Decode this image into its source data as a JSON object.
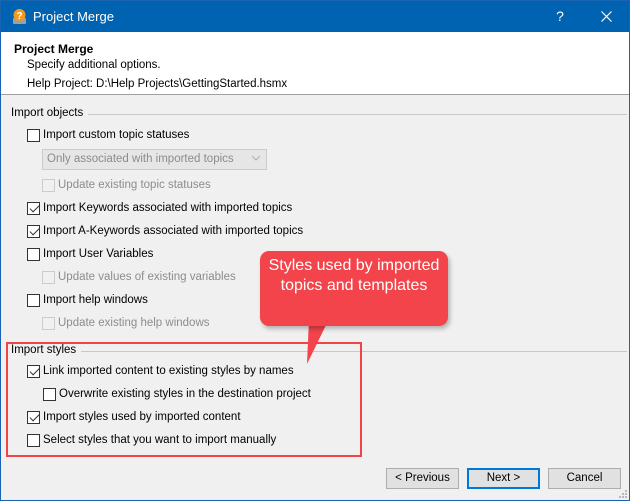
{
  "window": {
    "title": "Project Merge",
    "help_button": "?",
    "close_button": "✕",
    "icon": "help-project-icon"
  },
  "header": {
    "title": "Project Merge",
    "subtitle": "Specify additional options.",
    "help_project": "Help Project: D:\\Help Projects\\GettingStarted.hsmx"
  },
  "import_objects": {
    "label": "Import objects",
    "items": [
      {
        "label": "Import custom topic statuses",
        "checked": false,
        "enabled": true
      },
      {
        "label": "Update existing topic statuses",
        "checked": false,
        "enabled": false
      },
      {
        "label": "Import Keywords associated with imported topics",
        "checked": true,
        "enabled": true
      },
      {
        "label": "Import A-Keywords associated with imported topics",
        "checked": true,
        "enabled": true
      },
      {
        "label": "Import User Variables",
        "checked": false,
        "enabled": true
      },
      {
        "label": "Update values of existing variables",
        "checked": false,
        "enabled": false
      },
      {
        "label": "Import help windows",
        "checked": false,
        "enabled": true
      },
      {
        "label": "Update existing help windows",
        "checked": false,
        "enabled": false
      }
    ],
    "status_select": {
      "value": "Only associated with imported topics",
      "enabled": false
    }
  },
  "import_styles": {
    "label": "Import styles",
    "items": [
      {
        "label": "Link imported content to existing styles by names",
        "checked": true,
        "enabled": true
      },
      {
        "label": "Overwrite existing styles in the destination project",
        "checked": false,
        "enabled": true
      },
      {
        "label": "Import styles used by imported content",
        "checked": true,
        "enabled": true
      },
      {
        "label": "Select styles that you want to import manually",
        "checked": false,
        "enabled": true
      }
    ]
  },
  "annotation": {
    "callout_text": "Styles used by imported topics and templates",
    "highlight_color": "#f24447"
  },
  "buttons": {
    "previous": "< Previous",
    "next": "Next >",
    "cancel": "Cancel"
  },
  "colors": {
    "titlebar": "#0063b1",
    "accent": "#0078d7",
    "callout": "#f2444a"
  }
}
